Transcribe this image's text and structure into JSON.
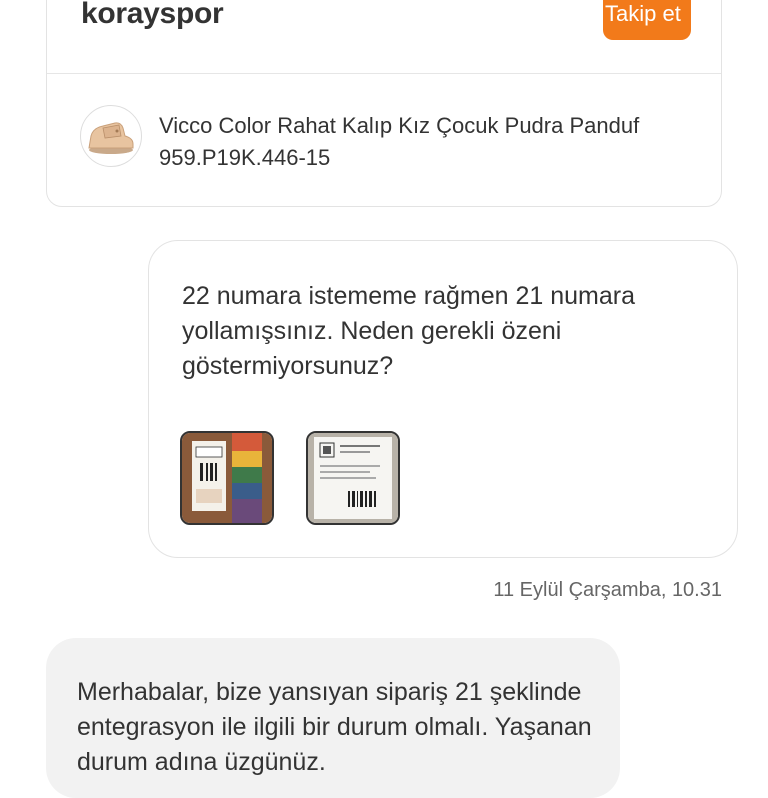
{
  "seller": {
    "name": "korayspor",
    "follow_label": "Takip et"
  },
  "product": {
    "thumbnail_icon": "shoe-thumbnail",
    "name": "Vicco Color Rahat Kalıp Kız Çocuk Pudra Panduf",
    "code": "959.P19K.446-15"
  },
  "messages": [
    {
      "direction": "outgoing",
      "text": "22 numara istememe rağmen 21 numara yollamışsınız. Neden gerekli özeni göstermiyorsunuz?",
      "attachments": [
        "box-label-photo",
        "shipping-label-photo"
      ],
      "timestamp": "11 Eylül Çarşamba, 10.31"
    },
    {
      "direction": "incoming",
      "text": "Merhabalar, bize yansıyan sipariş 21 şeklinde entegrasyon ile ilgili bir durum olmalı. Yaşanan durum adına üzgünüz."
    }
  ],
  "colors": {
    "accent": "#f27a1a",
    "incoming_bubble": "#f2f2f2",
    "border": "#e3e3e3"
  }
}
